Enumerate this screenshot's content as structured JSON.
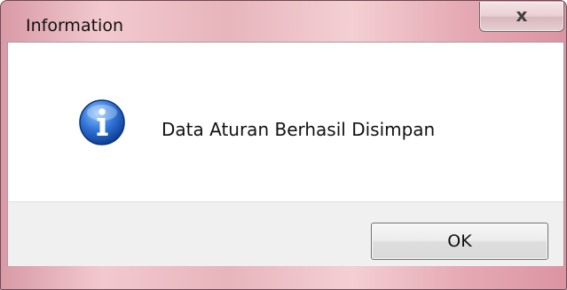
{
  "dialog": {
    "title": "Information",
    "message": "Data Aturan Berhasil Disimpan",
    "icon": "information-icon",
    "close_glyph": "x",
    "ok_label": "OK"
  },
  "colors": {
    "frame_accent": "#e7b5bc",
    "footer_background": "#f0f0f0",
    "icon_blue": "#1f5fbf"
  }
}
